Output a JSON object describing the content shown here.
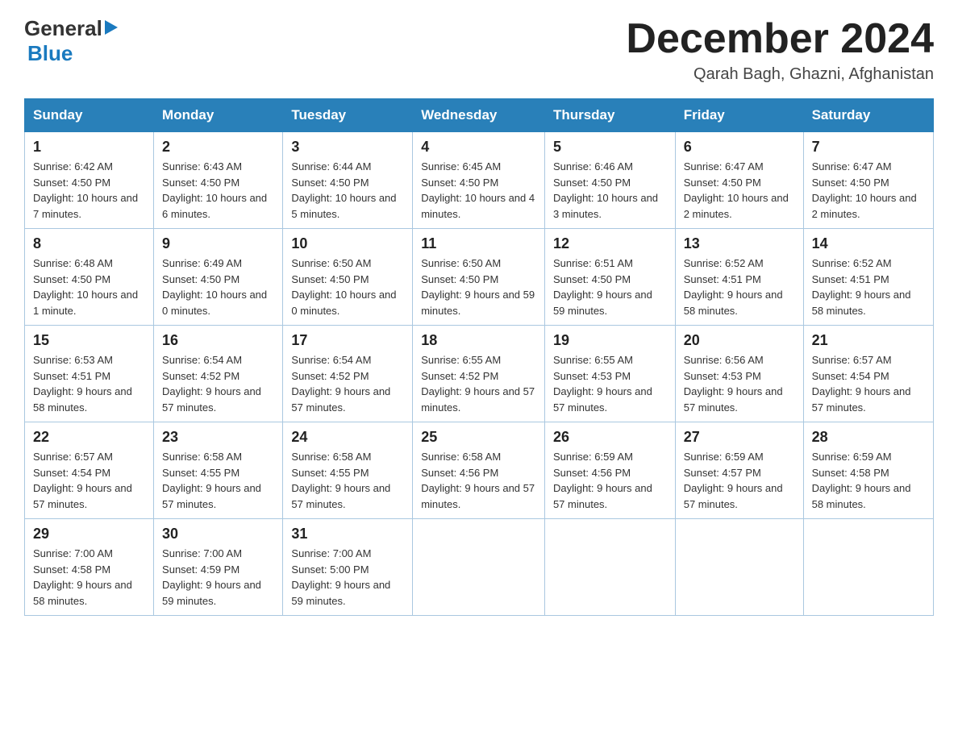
{
  "header": {
    "logo_general": "General",
    "logo_blue": "Blue",
    "month_title": "December 2024",
    "location": "Qarah Bagh, Ghazni, Afghanistan"
  },
  "weekdays": [
    "Sunday",
    "Monday",
    "Tuesday",
    "Wednesday",
    "Thursday",
    "Friday",
    "Saturday"
  ],
  "weeks": [
    [
      {
        "day": "1",
        "sunrise": "6:42 AM",
        "sunset": "4:50 PM",
        "daylight": "10 hours and 7 minutes."
      },
      {
        "day": "2",
        "sunrise": "6:43 AM",
        "sunset": "4:50 PM",
        "daylight": "10 hours and 6 minutes."
      },
      {
        "day": "3",
        "sunrise": "6:44 AM",
        "sunset": "4:50 PM",
        "daylight": "10 hours and 5 minutes."
      },
      {
        "day": "4",
        "sunrise": "6:45 AM",
        "sunset": "4:50 PM",
        "daylight": "10 hours and 4 minutes."
      },
      {
        "day": "5",
        "sunrise": "6:46 AM",
        "sunset": "4:50 PM",
        "daylight": "10 hours and 3 minutes."
      },
      {
        "day": "6",
        "sunrise": "6:47 AM",
        "sunset": "4:50 PM",
        "daylight": "10 hours and 2 minutes."
      },
      {
        "day": "7",
        "sunrise": "6:47 AM",
        "sunset": "4:50 PM",
        "daylight": "10 hours and 2 minutes."
      }
    ],
    [
      {
        "day": "8",
        "sunrise": "6:48 AM",
        "sunset": "4:50 PM",
        "daylight": "10 hours and 1 minute."
      },
      {
        "day": "9",
        "sunrise": "6:49 AM",
        "sunset": "4:50 PM",
        "daylight": "10 hours and 0 minutes."
      },
      {
        "day": "10",
        "sunrise": "6:50 AM",
        "sunset": "4:50 PM",
        "daylight": "10 hours and 0 minutes."
      },
      {
        "day": "11",
        "sunrise": "6:50 AM",
        "sunset": "4:50 PM",
        "daylight": "9 hours and 59 minutes."
      },
      {
        "day": "12",
        "sunrise": "6:51 AM",
        "sunset": "4:50 PM",
        "daylight": "9 hours and 59 minutes."
      },
      {
        "day": "13",
        "sunrise": "6:52 AM",
        "sunset": "4:51 PM",
        "daylight": "9 hours and 58 minutes."
      },
      {
        "day": "14",
        "sunrise": "6:52 AM",
        "sunset": "4:51 PM",
        "daylight": "9 hours and 58 minutes."
      }
    ],
    [
      {
        "day": "15",
        "sunrise": "6:53 AM",
        "sunset": "4:51 PM",
        "daylight": "9 hours and 58 minutes."
      },
      {
        "day": "16",
        "sunrise": "6:54 AM",
        "sunset": "4:52 PM",
        "daylight": "9 hours and 57 minutes."
      },
      {
        "day": "17",
        "sunrise": "6:54 AM",
        "sunset": "4:52 PM",
        "daylight": "9 hours and 57 minutes."
      },
      {
        "day": "18",
        "sunrise": "6:55 AM",
        "sunset": "4:52 PM",
        "daylight": "9 hours and 57 minutes."
      },
      {
        "day": "19",
        "sunrise": "6:55 AM",
        "sunset": "4:53 PM",
        "daylight": "9 hours and 57 minutes."
      },
      {
        "day": "20",
        "sunrise": "6:56 AM",
        "sunset": "4:53 PM",
        "daylight": "9 hours and 57 minutes."
      },
      {
        "day": "21",
        "sunrise": "6:57 AM",
        "sunset": "4:54 PM",
        "daylight": "9 hours and 57 minutes."
      }
    ],
    [
      {
        "day": "22",
        "sunrise": "6:57 AM",
        "sunset": "4:54 PM",
        "daylight": "9 hours and 57 minutes."
      },
      {
        "day": "23",
        "sunrise": "6:58 AM",
        "sunset": "4:55 PM",
        "daylight": "9 hours and 57 minutes."
      },
      {
        "day": "24",
        "sunrise": "6:58 AM",
        "sunset": "4:55 PM",
        "daylight": "9 hours and 57 minutes."
      },
      {
        "day": "25",
        "sunrise": "6:58 AM",
        "sunset": "4:56 PM",
        "daylight": "9 hours and 57 minutes."
      },
      {
        "day": "26",
        "sunrise": "6:59 AM",
        "sunset": "4:56 PM",
        "daylight": "9 hours and 57 minutes."
      },
      {
        "day": "27",
        "sunrise": "6:59 AM",
        "sunset": "4:57 PM",
        "daylight": "9 hours and 57 minutes."
      },
      {
        "day": "28",
        "sunrise": "6:59 AM",
        "sunset": "4:58 PM",
        "daylight": "9 hours and 58 minutes."
      }
    ],
    [
      {
        "day": "29",
        "sunrise": "7:00 AM",
        "sunset": "4:58 PM",
        "daylight": "9 hours and 58 minutes."
      },
      {
        "day": "30",
        "sunrise": "7:00 AM",
        "sunset": "4:59 PM",
        "daylight": "9 hours and 59 minutes."
      },
      {
        "day": "31",
        "sunrise": "7:00 AM",
        "sunset": "5:00 PM",
        "daylight": "9 hours and 59 minutes."
      },
      null,
      null,
      null,
      null
    ]
  ],
  "labels": {
    "sunrise": "Sunrise:",
    "sunset": "Sunset:",
    "daylight": "Daylight:"
  }
}
